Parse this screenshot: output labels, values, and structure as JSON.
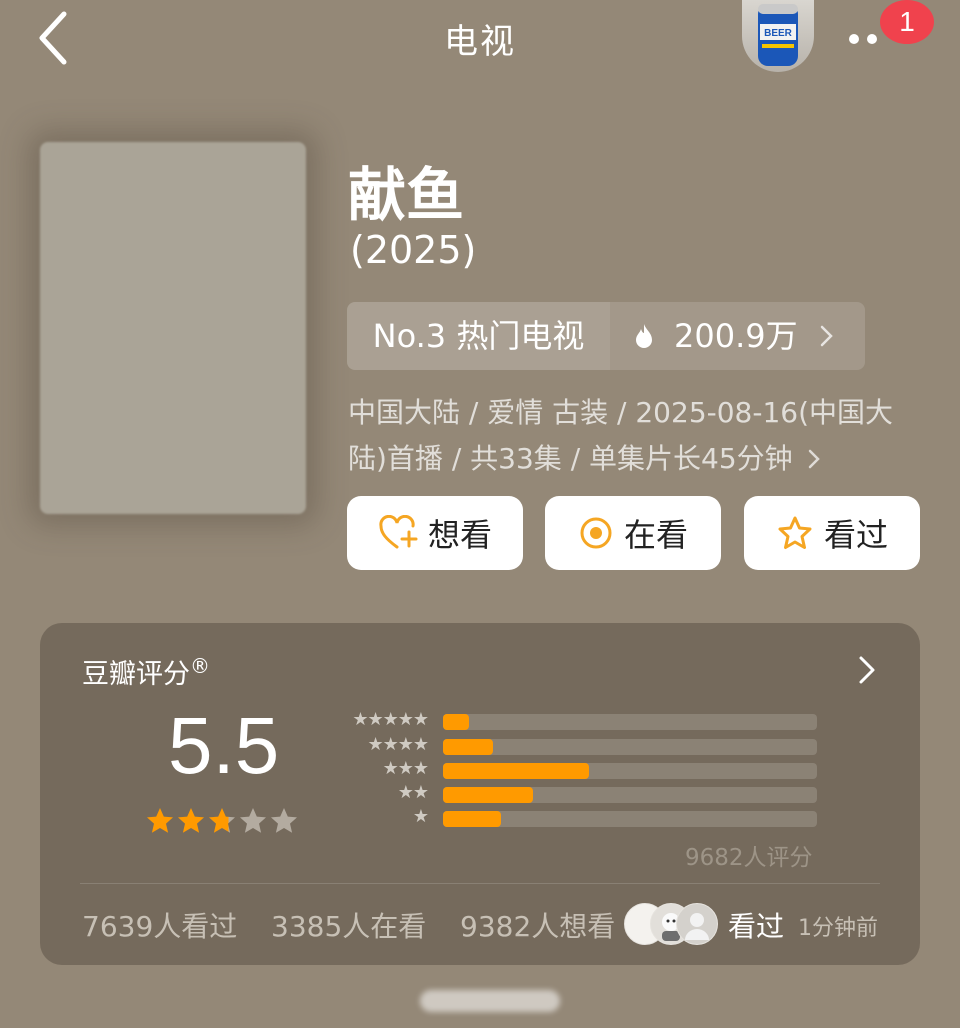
{
  "header": {
    "title": "电视",
    "notification_count": "1"
  },
  "subject": {
    "title": "献鱼",
    "year": "(2025)"
  },
  "ranking": {
    "label": "No.3 热门电视",
    "heat": "200.9万"
  },
  "meta": {
    "text": "中国大陆 / 爱情 古装 / 2025-08-16(中国大陆)首播 / 共33集 / 单集片长45分钟"
  },
  "actions": [
    {
      "label": "想看",
      "icon": "heart-plus-icon"
    },
    {
      "label": "在看",
      "icon": "circle-dot-icon"
    },
    {
      "label": "看过",
      "icon": "star-outline-icon"
    }
  ],
  "rating": {
    "label": "豆瓣评分",
    "mark": "®",
    "score": "5.5",
    "stars": 2.75,
    "distribution": [
      {
        "stars": "★★★★★",
        "value": 0.07
      },
      {
        "stars": "★★★★",
        "value": 0.135
      },
      {
        "stars": "★★★",
        "value": 0.39
      },
      {
        "stars": "★★",
        "value": 0.24
      },
      {
        "stars": "★",
        "value": 0.155
      }
    ],
    "count": "9682人评分"
  },
  "stats": {
    "watched": "7639人看过",
    "watching": "3385人在看",
    "want": "9382人想看",
    "friend_status": "看过",
    "friend_time": "1分钟前"
  },
  "colors": {
    "background": "#948877",
    "card": "#756a5c",
    "accent": "#ff9a00",
    "badge": "#f0424d"
  }
}
